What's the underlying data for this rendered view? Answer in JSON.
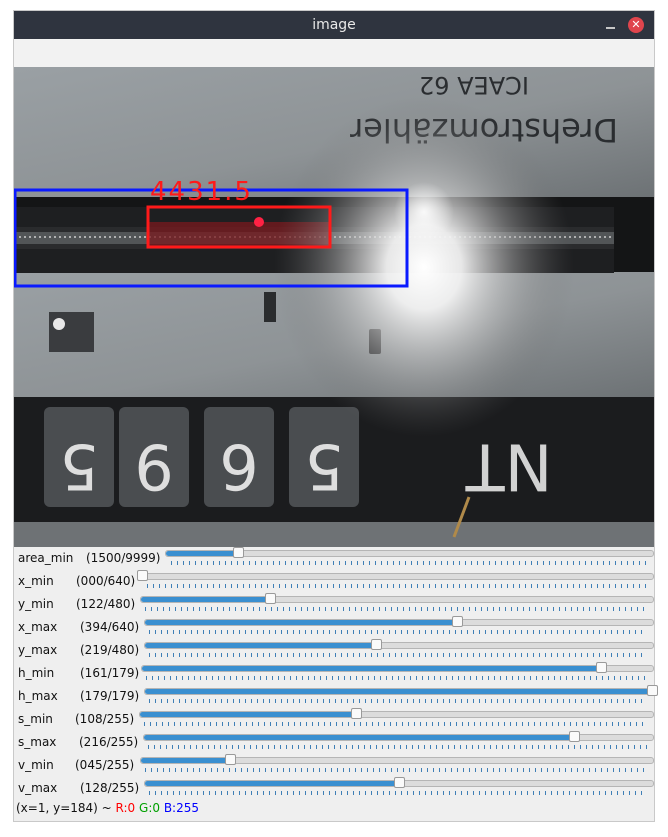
{
  "window": {
    "title": "image"
  },
  "image": {
    "overlay_text": "4431.5",
    "photo_text_meter": "Drehstromzähler",
    "photo_text_model": "ICAEA 62",
    "photo_digits": [
      "5",
      "9",
      "6",
      "5"
    ],
    "photo_text_nt": "NT",
    "colors": {
      "blue_box": "#0a1aff",
      "red_box": "#ff1a1a",
      "red_dot": "#ff2244"
    }
  },
  "trackbars": [
    {
      "label": "area_min",
      "value_text": "(1500/9999)",
      "value": 1500,
      "max": 9999
    },
    {
      "label": "x_min",
      "value_text": "(000/640)",
      "value": 0,
      "max": 640
    },
    {
      "label": "y_min",
      "value_text": "(122/480)",
      "value": 122,
      "max": 480
    },
    {
      "label": "x_max",
      "value_text": "(394/640)",
      "value": 394,
      "max": 640
    },
    {
      "label": "y_max",
      "value_text": "(219/480)",
      "value": 219,
      "max": 480
    },
    {
      "label": "h_min",
      "value_text": "(161/179)",
      "value": 161,
      "max": 179
    },
    {
      "label": "h_max",
      "value_text": "(179/179)",
      "value": 179,
      "max": 179
    },
    {
      "label": "s_min",
      "value_text": "(108/255)",
      "value": 108,
      "max": 255
    },
    {
      "label": "s_max",
      "value_text": "(216/255)",
      "value": 216,
      "max": 255
    },
    {
      "label": "v_min",
      "value_text": "(045/255)",
      "value": 45,
      "max": 255
    },
    {
      "label": "v_max",
      "value_text": "(128/255)",
      "value": 128,
      "max": 255
    }
  ],
  "status": {
    "coords": "(x=1, y=184) ~ ",
    "r": "R:0",
    "g": "G:0",
    "b": "B:255",
    "colors": {
      "r": "#ff0000",
      "g": "#00a000",
      "b": "#0000ff"
    }
  }
}
